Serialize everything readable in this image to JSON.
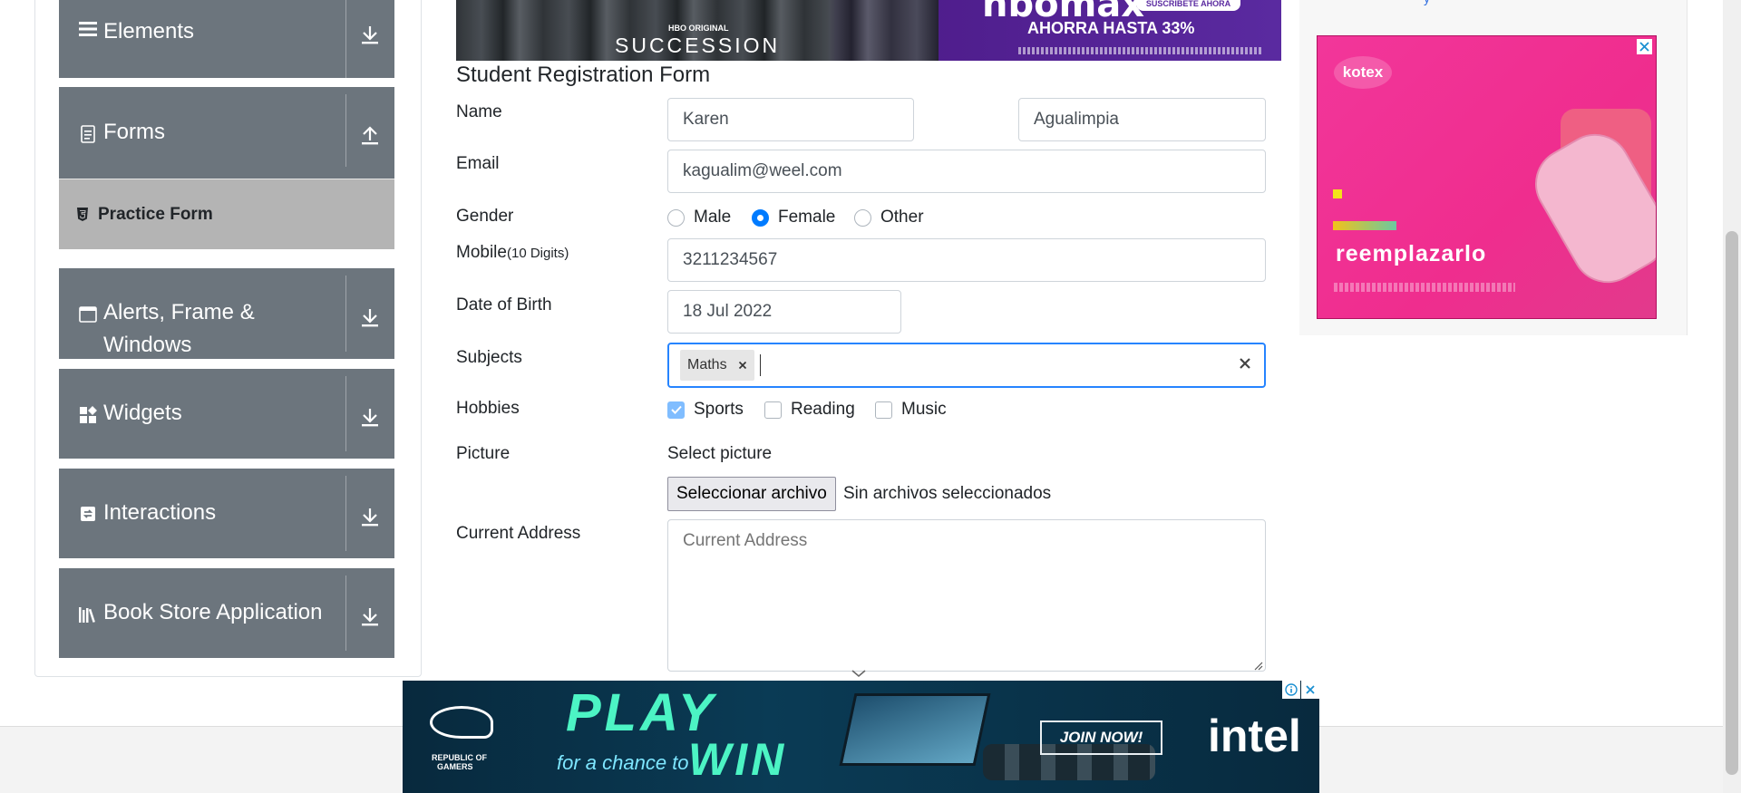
{
  "sidebar": {
    "groups": [
      {
        "title": "Elements",
        "icon": "menu-bars-icon",
        "arrow": "download-arrow-icon"
      },
      {
        "title": "Forms",
        "icon": "document-icon",
        "arrow": "upload-arrow-icon"
      },
      {
        "title": "Alerts, Frame & Windows",
        "title_line1": "Alerts, Frame &",
        "title_line2": "Windows",
        "icon": "window-icon",
        "arrow": "download-arrow-icon"
      },
      {
        "title": "Widgets",
        "icon": "widgets-icon",
        "arrow": "download-arrow-icon"
      },
      {
        "title": "Interactions",
        "icon": "interactions-icon",
        "arrow": "download-arrow-icon"
      },
      {
        "title": "Book Store Application",
        "icon": "books-icon",
        "arrow": "download-arrow-icon"
      }
    ],
    "active_item": {
      "label": "Practice Form",
      "icon": "html5-icon"
    }
  },
  "ads": {
    "top": {
      "small_brand": "HBO ORIGINAL",
      "show": "SUCCESSION",
      "brand": "hbomax",
      "cta": "SUSCRÍBETE AHORA",
      "offer": "AHORRA HASTA 33%"
    },
    "side": {
      "brand": "kotex",
      "text": "reemplazarlo",
      "link": "y"
    },
    "bottom": {
      "play": "PLAY",
      "chance": "for a chance to",
      "win": "WIN",
      "cta": "JOIN NOW!",
      "brand": "intel",
      "rog_line1": "REPUBLIC OF",
      "rog_line2": "GAMERS"
    }
  },
  "form": {
    "title": "Student Registration Form",
    "name_label": "Name",
    "first_name": "Karen",
    "last_name": "Agualimpia",
    "email_label": "Email",
    "email": "kagualim@weel.com",
    "gender_label": "Gender",
    "gender_options": [
      "Male",
      "Female",
      "Other"
    ],
    "gender_selected": "Female",
    "mobile_label": "Mobile",
    "mobile_hint": "(10 Digits)",
    "mobile": "3211234567",
    "dob_label": "Date of Birth",
    "dob": "18 Jul 2022",
    "subjects_label": "Subjects",
    "subjects": [
      "Maths"
    ],
    "hobbies_label": "Hobbies",
    "hobbies": [
      {
        "label": "Sports",
        "checked": true
      },
      {
        "label": "Reading",
        "checked": false
      },
      {
        "label": "Music",
        "checked": false
      }
    ],
    "picture_label": "Picture",
    "picture_prompt": "Select picture",
    "upload_button": "Seleccionar archivo",
    "upload_status": "Sin archivos seleccionados",
    "address_label": "Current Address",
    "address_placeholder": "Current Address"
  },
  "colors": {
    "sidebar_group": "#6c757d",
    "active_item": "#b4b4b4",
    "accent": "#007bff",
    "focus_border": "#2684ff"
  }
}
